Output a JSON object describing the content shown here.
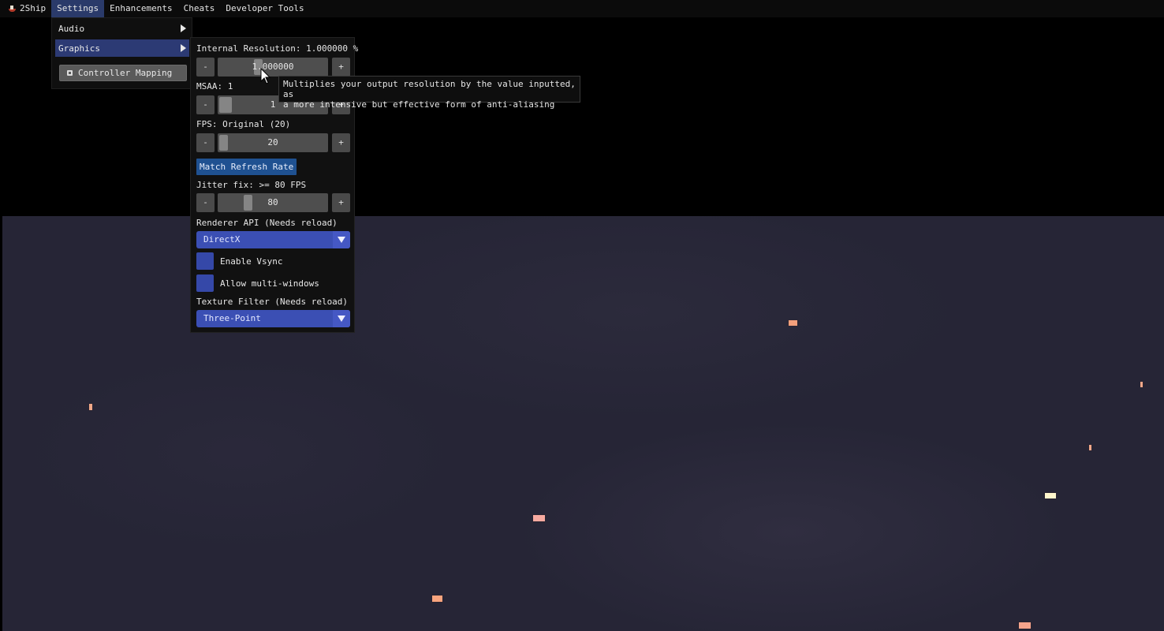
{
  "menubar": {
    "app_icon": "ship-icon",
    "items": [
      {
        "label": "2Ship"
      },
      {
        "label": "Settings",
        "active": true
      },
      {
        "label": "Enhancements"
      },
      {
        "label": "Cheats"
      },
      {
        "label": "Developer Tools"
      }
    ]
  },
  "settings_menu": {
    "items": [
      {
        "label": "Audio",
        "icon": "chevron-right-icon"
      },
      {
        "label": "Graphics",
        "icon": "chevron-right-icon",
        "highlighted": true
      }
    ],
    "controller_button": {
      "label": "Controller Mapping",
      "icon": "gamepad-icon"
    }
  },
  "graphics_panel": {
    "internal_resolution": {
      "label": "Internal Resolution: 1.000000 %",
      "value": "1.000000",
      "minus": "-",
      "plus": "+",
      "fraction": 0.35
    },
    "msaa": {
      "label": "MSAA: 1",
      "value": "1",
      "minus": "-",
      "plus": "+",
      "fraction": 0.0
    },
    "fps": {
      "label": "FPS: Original (20)",
      "value": "20",
      "minus": "-",
      "plus": "+",
      "fraction": 0.0
    },
    "match_refresh_button": "Match Refresh Rate",
    "jitter_fix": {
      "label": "Jitter fix: >= 80 FPS",
      "value": "80",
      "minus": "-",
      "plus": "+",
      "fraction": 0.25
    },
    "renderer_api": {
      "label": "Renderer API (Needs reload)",
      "selected": "DirectX"
    },
    "enable_vsync": {
      "label": "Enable Vsync",
      "checked": false
    },
    "allow_multi_windows": {
      "label": "Allow multi-windows",
      "checked": false
    },
    "texture_filter": {
      "label": "Texture Filter (Needs reload)",
      "selected": "Three-Point"
    }
  },
  "tooltip": {
    "line1": "Multiplies your output resolution by the value inputted, as",
    "line2": "a more intensive but effective form of anti-aliasing"
  },
  "colors": {
    "menu_active": "#2a3a6a",
    "accent_blue": "#3b4fb4",
    "button_blue": "#1f5191",
    "game_bg": "#262536",
    "sprite_orange": "#f4a582",
    "sprite_yellow": "#fff8d0"
  }
}
